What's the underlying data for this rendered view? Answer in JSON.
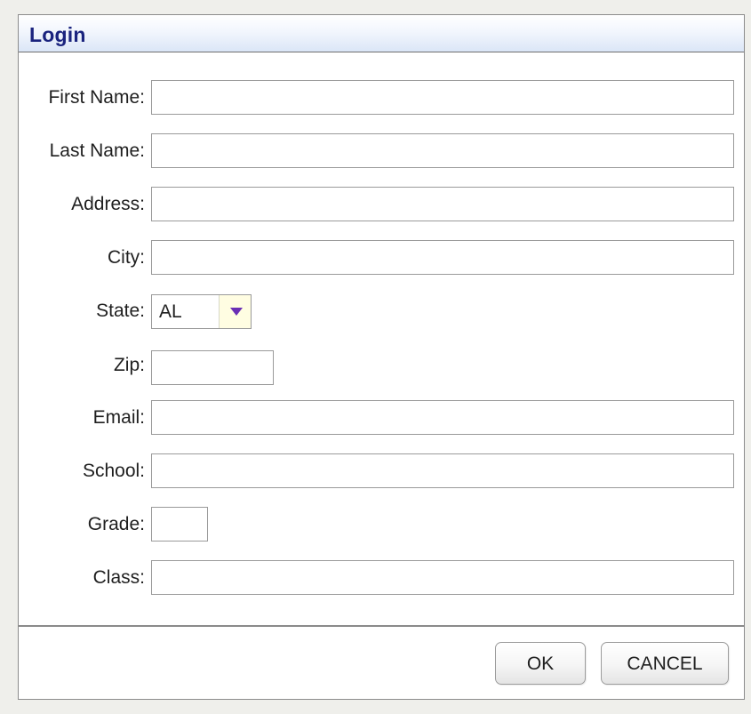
{
  "dialog": {
    "title": "Login"
  },
  "form": {
    "first_name": {
      "label": "First Name:",
      "value": ""
    },
    "last_name": {
      "label": "Last Name:",
      "value": ""
    },
    "address": {
      "label": "Address:",
      "value": ""
    },
    "city": {
      "label": "City:",
      "value": ""
    },
    "state": {
      "label": "State:",
      "selected": "AL"
    },
    "zip": {
      "label": "Zip:",
      "value": ""
    },
    "email": {
      "label": "Email:",
      "value": ""
    },
    "school": {
      "label": "School:",
      "value": ""
    },
    "grade": {
      "label": "Grade:",
      "value": ""
    },
    "class": {
      "label": "Class:",
      "value": ""
    }
  },
  "buttons": {
    "ok_label": "OK",
    "cancel_label": "CANCEL"
  },
  "colors": {
    "title": "#1a237e",
    "dropdown_arrow": "#6a2fb5",
    "dropdown_button_bg": "#fffde2"
  },
  "icons": {
    "dropdown": "triangle-down-icon"
  }
}
